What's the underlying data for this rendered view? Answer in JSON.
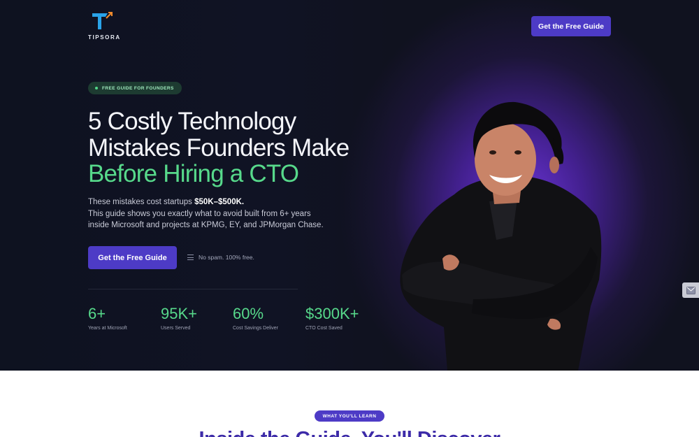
{
  "brand": {
    "name": "TIPSORA",
    "colors": {
      "accent": "#4d3bc6",
      "green": "#57d98b",
      "dark": "#10121f"
    }
  },
  "nav": {
    "cta_label": "Get the Free Guide"
  },
  "hero": {
    "pill": "FREE GUIDE FOR FOUNDERS",
    "headline": {
      "line1": "5 Costly Technology",
      "line2": "Mistakes Founders Make",
      "line3": "Before Hiring a CTO"
    },
    "subcopy": {
      "lead": "These mistakes cost startups ",
      "highlight": "$50K–$500K.",
      "line2": "This guide shows you exactly what to avoid built from 6+ years",
      "line3": "inside Microsoft and projects at KPMG, EY, and JPMorgan Chase."
    },
    "cta_label": "Get the Free Guide",
    "note": "No spam. 100% free.",
    "stats": [
      {
        "value": "6+",
        "label": "Years at Microsoft"
      },
      {
        "value": "95K+",
        "label": "Users Served"
      },
      {
        "value": "60%",
        "label": "Cost Savings Deliver"
      },
      {
        "value": "$300K+",
        "label": "CTO Cost Saved"
      }
    ]
  },
  "section": {
    "badge": "WHAT YOU'LL LEARN",
    "title": "Inside the Guide, You'll Discover"
  },
  "icons": {
    "note": "list-icon",
    "widget": "mail-icon"
  }
}
